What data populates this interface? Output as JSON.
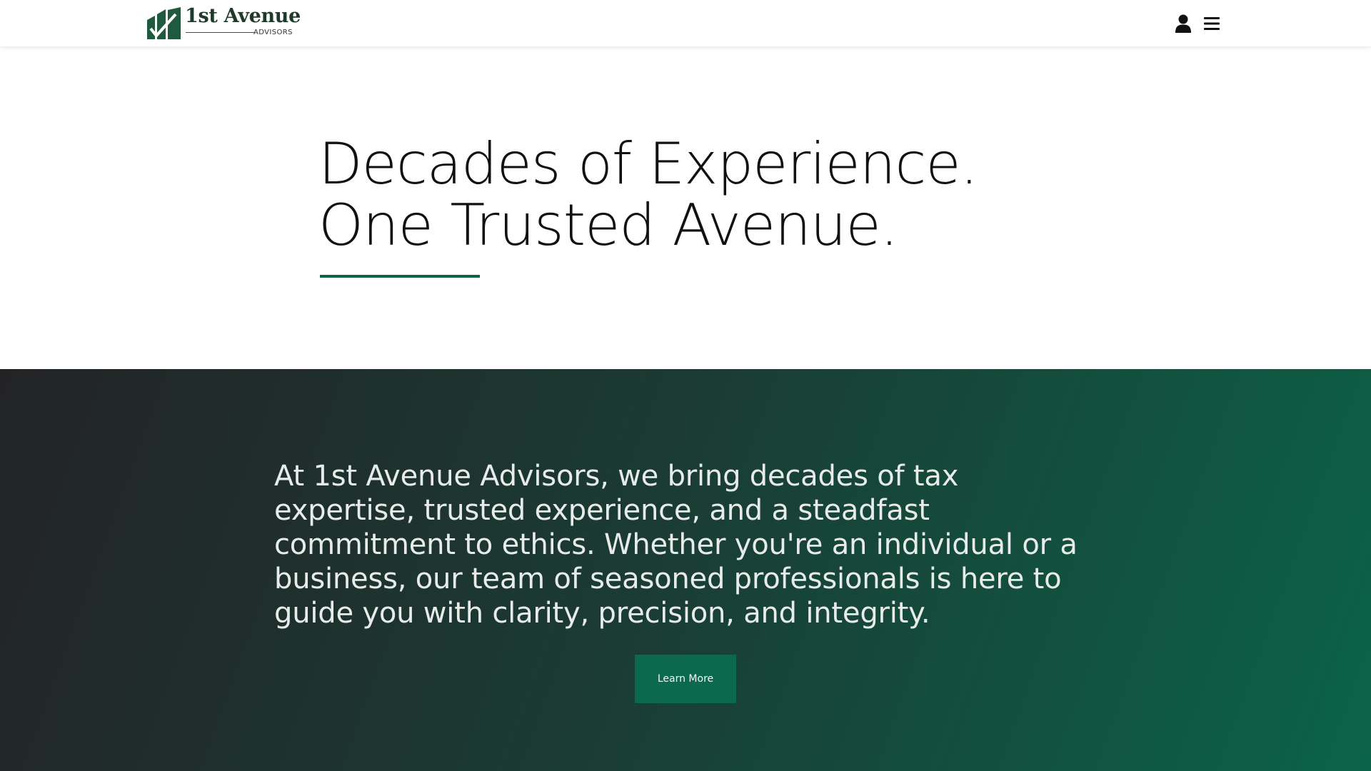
{
  "header": {
    "logo": {
      "name": "1st Avenue",
      "subtitle": "ADVISORS"
    },
    "icons": [
      "user-icon",
      "menu-icon"
    ]
  },
  "hero": {
    "title_line_1": "Decades of Experience.",
    "title_line_2": "One Trusted Avenue."
  },
  "intro": {
    "text": "At 1st Avenue Advisors, we bring decades of tax expertise, trusted experience, and a steadfast commitment to ethics. Whether you're an individual or a business, our team of seasoned professionals is here to guide you with clarity, precision, and integrity.",
    "button_label": "Learn More"
  },
  "colors": {
    "brand_green": "#0b6a4d",
    "underline_green": "#0d6149",
    "band_start": "#232326",
    "band_end": "#0b6348"
  }
}
